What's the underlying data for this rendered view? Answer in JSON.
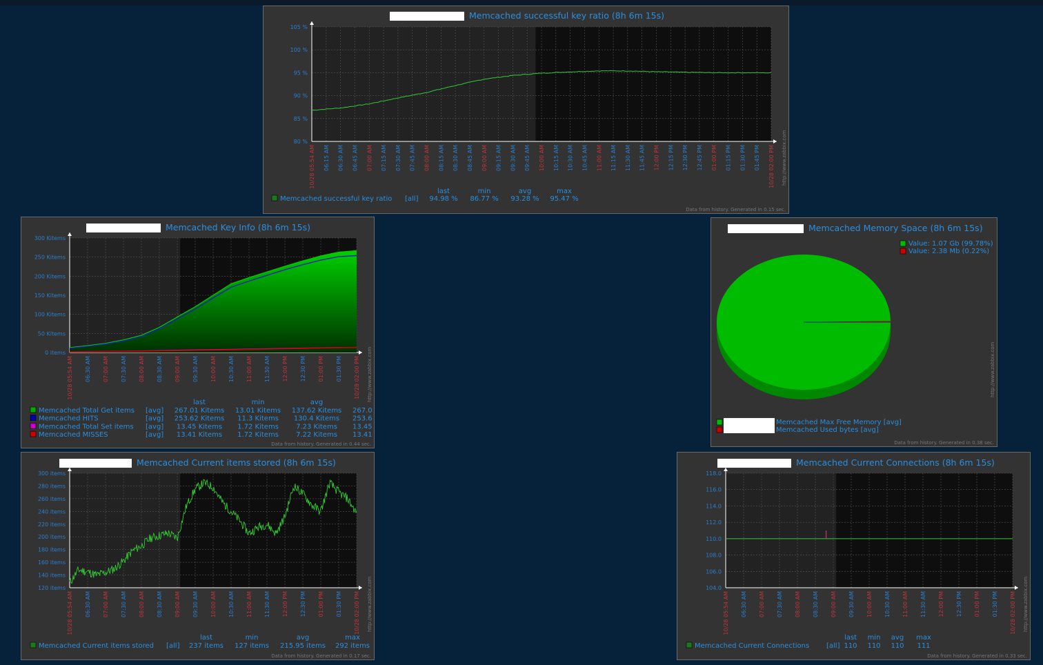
{
  "colors": {
    "background": "#05223a",
    "panel": "#333333",
    "accent": "#2a8fe0",
    "green": "#00bb00",
    "blue": "#0000cc",
    "magenta": "#cc00cc",
    "red": "#cc0000"
  },
  "footer_url": "http://www.zabbix.com",
  "time_ticks": [
    "10/28 05:54 AM",
    "06:30 AM",
    "07:00 AM",
    "07:30 AM",
    "08:00 AM",
    "08:30 AM",
    "09:00 AM",
    "09:30 AM",
    "10:00 AM",
    "10:30 AM",
    "11:00 AM",
    "11:30 AM",
    "12:00 PM",
    "12:30 PM",
    "01:00 PM",
    "01:30 PM",
    "10/28 02:00 PM"
  ],
  "time_ticks_15": [
    "10/28 05:54 AM",
    "06:15 AM",
    "06:30 AM",
    "06:45 AM",
    "07:00 AM",
    "07:15 AM",
    "07:30 AM",
    "07:45 AM",
    "08:00 AM",
    "08:15 AM",
    "08:30 AM",
    "08:45 AM",
    "09:00 AM",
    "09:15 AM",
    "09:30 AM",
    "09:45 AM",
    "10:00 AM",
    "10:15 AM",
    "10:30 AM",
    "10:45 AM",
    "11:00 AM",
    "11:15 AM",
    "11:30 AM",
    "11:45 AM",
    "12:00 PM",
    "12:15 PM",
    "12:30 PM",
    "12:45 PM",
    "01:00 PM",
    "01:15 PM",
    "01:30 PM",
    "01:45 PM",
    "10/28 02:00 PM"
  ],
  "graphs": {
    "ratio": {
      "title": "Memcached successful key ratio (8h 6m 15s)",
      "y_ticks": [
        "105 %",
        "100 %",
        "95 %",
        "90 %",
        "85 %",
        "80 %"
      ],
      "legend_headers": [
        "last",
        "min",
        "avg",
        "max"
      ],
      "series": [
        {
          "name": "Memcached successful key ratio",
          "func": "[all]",
          "last": "94.98 %",
          "min": "86.77 %",
          "avg": "93.28 %",
          "max": "95.47 %"
        }
      ],
      "footer": "Data from history. Generated in 0.15 sec."
    },
    "keyinfo": {
      "title": "Memcached Key Info (8h 6m 15s)",
      "y_ticks": [
        "300 Kitems",
        "250 Kitems",
        "200 Kitems",
        "150 Kitems",
        "100 Kitems",
        "50 Kitems",
        "0 items"
      ],
      "legend_headers": [
        "last",
        "min",
        "avg"
      ],
      "series": [
        {
          "name": "Memcached Total Get items",
          "func": "[avg]",
          "last": "267.01 Kitems",
          "min": "13.01 Kitems",
          "avg": "137.62 Kitems",
          "max": "267.0"
        },
        {
          "name": "Memcached HITS",
          "func": "[avg]",
          "last": "253.62 Kitems",
          "min": "11.3 Kitems",
          "avg": "130.4 Kitems",
          "max": "253.6"
        },
        {
          "name": "Memcached Total Set items",
          "func": "[avg]",
          "last": "13.45 Kitems",
          "min": "1.72 Kitems",
          "avg": "7.23 Kitems",
          "max": "13.45"
        },
        {
          "name": "Memcached MISSES",
          "func": "[avg]",
          "last": "13.41 Kitems",
          "min": "1.72 Kitems",
          "avg": "7.22 Kitems",
          "max": "13.41"
        }
      ],
      "footer": "Data from history. Generated in 0.44 sec."
    },
    "memory": {
      "title": "Memcached Memory Space (8h 6m 15s)",
      "slices": [
        {
          "label": "Value: 1.07 Gb (99.78%)",
          "percent": 99.78
        },
        {
          "label": "Value: 2.38 Mb (0.22%)",
          "percent": 0.22
        }
      ],
      "legend": [
        {
          "name": "Memcached Max Free Memory [avg]"
        },
        {
          "name": "Memcached Used bytes     [avg]"
        }
      ],
      "footer": "Data from history. Generated in 0.38 sec."
    },
    "items": {
      "title": "Memcached Current items stored (8h 6m 15s)",
      "y_ticks": [
        "300 items",
        "280 items",
        "260 items",
        "240 items",
        "220 items",
        "200 items",
        "180 items",
        "160 items",
        "140 items",
        "120 items"
      ],
      "legend_headers": [
        "last",
        "min",
        "avg",
        "max"
      ],
      "series": [
        {
          "name": "Memcached Current items stored",
          "func": "[all]",
          "last": "237 items",
          "min": "127 items",
          "avg": "215.95 items",
          "max": "292 items"
        }
      ],
      "footer": "Data from history. Generated in 0.17 sec."
    },
    "conn": {
      "title": "Memcached Current Connections (8h 6m 15s)",
      "y_ticks": [
        "118.0",
        "116.0",
        "114.0",
        "112.0",
        "110.0",
        "108.0",
        "106.0",
        "104.0"
      ],
      "legend_headers": [
        "last",
        "min",
        "avg",
        "max"
      ],
      "series": [
        {
          "name": "Memcached Current Connections",
          "func": "[all]",
          "last": "110",
          "min": "110",
          "avg": "110",
          "max": "111"
        }
      ],
      "footer": "Data from history. Generated in 0.33 sec."
    }
  },
  "chart_data": [
    {
      "type": "line",
      "title": "Memcached successful key ratio (8h 6m 15s)",
      "ylim": [
        80,
        105
      ],
      "x": [
        "05:54",
        "06:30",
        "07:00",
        "07:30",
        "08:00",
        "08:30",
        "09:00",
        "09:30",
        "10:00",
        "10:30",
        "11:00",
        "11:30",
        "12:00",
        "12:30",
        "01:00",
        "01:30",
        "02:00"
      ],
      "series": [
        {
          "name": "Memcached successful key ratio",
          "values": [
            86.8,
            87.3,
            88.2,
            89.5,
            90.7,
            92.2,
            93.6,
            94.4,
            94.9,
            95.2,
            95.4,
            95.4,
            95.2,
            95.1,
            95.0,
            95.0,
            94.98
          ]
        }
      ]
    },
    {
      "type": "area",
      "title": "Memcached Key Info (8h 6m 15s)",
      "ylim": [
        0,
        300
      ],
      "x": [
        "05:54",
        "06:30",
        "07:00",
        "07:30",
        "08:00",
        "08:30",
        "09:00",
        "09:30",
        "10:00",
        "10:30",
        "11:00",
        "11:30",
        "12:00",
        "12:30",
        "01:00",
        "01:30",
        "02:00"
      ],
      "series": [
        {
          "name": "Memcached Total Get items",
          "values": [
            13,
            18,
            24,
            33,
            45,
            66,
            93,
            120,
            150,
            180,
            196,
            211,
            226,
            240,
            253,
            263,
            267
          ]
        },
        {
          "name": "Memcached HITS",
          "values": [
            11,
            16,
            22,
            30,
            42,
            62,
            88,
            114,
            143,
            171,
            187,
            202,
            217,
            230,
            242,
            251,
            254
          ]
        },
        {
          "name": "Memcached Total Set items",
          "values": [
            2,
            2.5,
            3,
            3.5,
            4.2,
            5,
            6,
            6.8,
            7.5,
            8.3,
            9,
            9.8,
            10.6,
            11.5,
            12.3,
            13,
            13.45
          ]
        },
        {
          "name": "Memcached MISSES",
          "values": [
            1.7,
            2,
            2.4,
            3,
            3.6,
            4.2,
            5,
            5.8,
            6.5,
            7.3,
            8.1,
            8.9,
            9.8,
            10.8,
            11.7,
            12.6,
            13.41
          ]
        }
      ]
    },
    {
      "type": "pie",
      "title": "Memcached Memory Space (8h 6m 15s)",
      "labels": [
        "Value: 1.07 Gb (99.78%)",
        "Value: 2.38 Mb (0.22%)"
      ],
      "values": [
        99.78,
        0.22
      ]
    },
    {
      "type": "line",
      "title": "Memcached Current items stored (8h 6m 15s)",
      "ylim": [
        120,
        300
      ],
      "x": [
        "05:54",
        "06:15",
        "06:30",
        "06:45",
        "07:00",
        "07:15",
        "07:30",
        "07:45",
        "08:00",
        "08:15",
        "08:30",
        "08:45",
        "09:00",
        "09:15",
        "09:30",
        "09:45",
        "10:00",
        "10:15",
        "10:30",
        "10:45",
        "11:00",
        "11:15",
        "11:30",
        "11:45",
        "12:00",
        "12:15",
        "12:30",
        "12:45",
        "01:00",
        "01:15",
        "01:30",
        "01:45",
        "02:00"
      ],
      "series": [
        {
          "name": "Memcached Current items stored",
          "values": [
            128,
            148,
            145,
            140,
            144,
            150,
            162,
            178,
            186,
            198,
            202,
            206,
            198,
            248,
            275,
            285,
            278,
            255,
            240,
            225,
            205,
            215,
            220,
            205,
            232,
            280,
            268,
            250,
            240,
            285,
            270,
            260,
            237
          ]
        }
      ]
    },
    {
      "type": "line",
      "title": "Memcached Current Connections (8h 6m 15s)",
      "ylim": [
        104,
        118
      ],
      "x": [
        "05:54",
        "08:50",
        "08:51",
        "02:00"
      ],
      "series": [
        {
          "name": "Memcached Current Connections",
          "values": [
            110,
            110,
            111,
            110
          ]
        }
      ]
    }
  ]
}
